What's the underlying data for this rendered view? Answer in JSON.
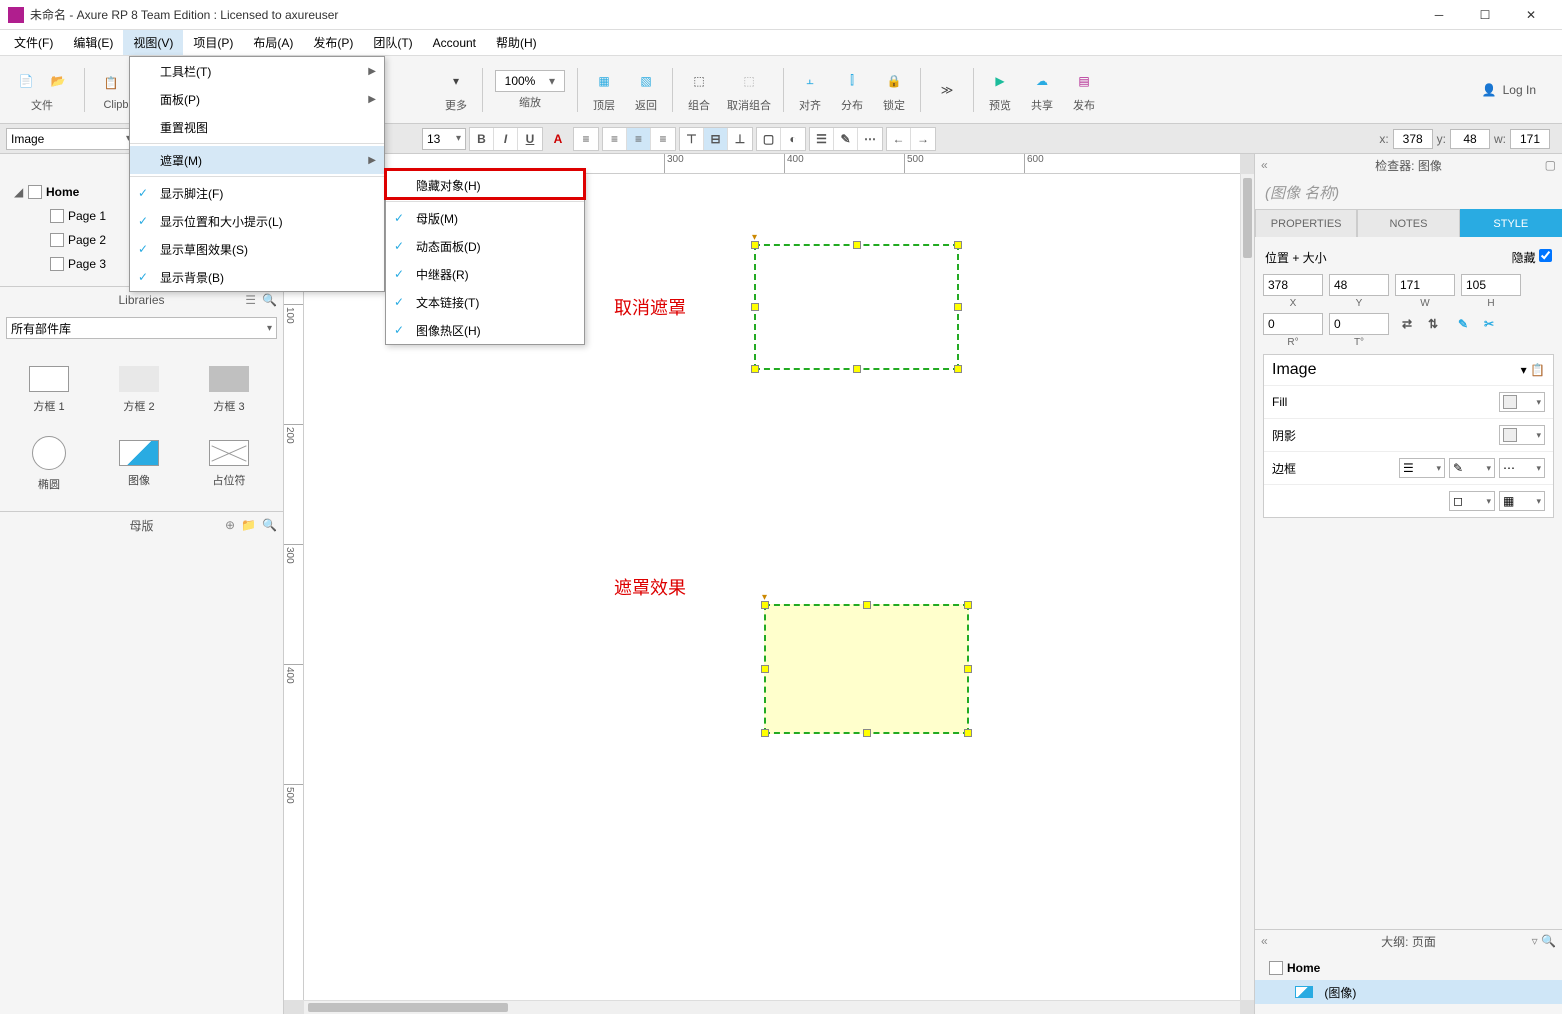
{
  "title": "未命名 - Axure RP 8 Team Edition : Licensed to axureuser",
  "menus": [
    "文件(F)",
    "编辑(E)",
    "视图(V)",
    "项目(P)",
    "布局(A)",
    "发布(P)",
    "团队(T)",
    "Account",
    "帮助(H)"
  ],
  "activeMenu": 2,
  "toolbar": {
    "file": "文件",
    "clipboard": "Clipboard",
    "more": "更多",
    "zoom": "缩放",
    "zoomVal": "100%",
    "front": "顶层",
    "back": "返回",
    "group": "组合",
    "ungroup": "取消组合",
    "align": "对齐",
    "distribute": "分布",
    "lock": "锁定",
    "preview": "预览",
    "share": "共享",
    "publish": "发布",
    "login": "Log In"
  },
  "fmt": {
    "widget": "Image",
    "fontSize": "13"
  },
  "coords": {
    "xLabel": "x:",
    "x": "378",
    "yLabel": "y:",
    "y": "48",
    "wLabel": "w:",
    "w": "171"
  },
  "pages": {
    "root": "Home",
    "items": [
      "Page 1",
      "Page 2",
      "Page 3"
    ]
  },
  "libs": {
    "title": "Libraries",
    "selector": "所有部件库",
    "items": [
      "方框 1",
      "方框 2",
      "方框 3",
      "椭圆",
      "图像",
      "占位符"
    ]
  },
  "masters": "母版",
  "viewMenu": {
    "items": [
      {
        "label": "工具栏(T)",
        "arrow": true
      },
      {
        "label": "面板(P)",
        "arrow": true
      },
      {
        "label": "重置视图"
      },
      {
        "sep": true
      },
      {
        "label": "遮罩(M)",
        "arrow": true,
        "hl": true
      },
      {
        "sep": true
      },
      {
        "label": "显示脚注(F)",
        "check": true
      },
      {
        "label": "显示位置和大小提示(L)",
        "check": true
      },
      {
        "label": "显示草图效果(S)",
        "check": true
      },
      {
        "label": "显示背景(B)",
        "check": true
      }
    ]
  },
  "maskMenu": {
    "items": [
      {
        "label": "隐藏对象(H)"
      },
      {
        "sep": true
      },
      {
        "label": "母版(M)",
        "check": true
      },
      {
        "label": "动态面板(D)",
        "check": true
      },
      {
        "label": "中继器(R)",
        "check": true
      },
      {
        "label": "文本链接(T)",
        "check": true
      },
      {
        "label": "图像热区(H)",
        "check": true
      }
    ]
  },
  "annotations": {
    "cancel": "取消遮罩",
    "effect": "遮罩效果"
  },
  "ruler_h": [
    300,
    400,
    500,
    600
  ],
  "ruler_v": [
    100,
    200,
    300,
    400,
    500
  ],
  "inspector": {
    "title": "检查器: 图像",
    "placeholder": "(图像 名称)",
    "tabs": [
      "PROPERTIES",
      "NOTES",
      "STYLE"
    ],
    "activeTab": 2,
    "posLabel": "位置 + 大小",
    "hideLabel": "隐藏",
    "x": "378",
    "y": "48",
    "w": "171",
    "h": "105",
    "r1": "0",
    "r2": "0",
    "xl": "X",
    "yl": "Y",
    "wl": "W",
    "hl": "H",
    "rl1": "R°",
    "rl2": "T°",
    "styleName": "Image",
    "fill": "Fill",
    "shadow": "阴影",
    "border": "边框"
  },
  "outline": {
    "title": "大纲: 页面",
    "root": "Home",
    "item": "(图像)"
  }
}
